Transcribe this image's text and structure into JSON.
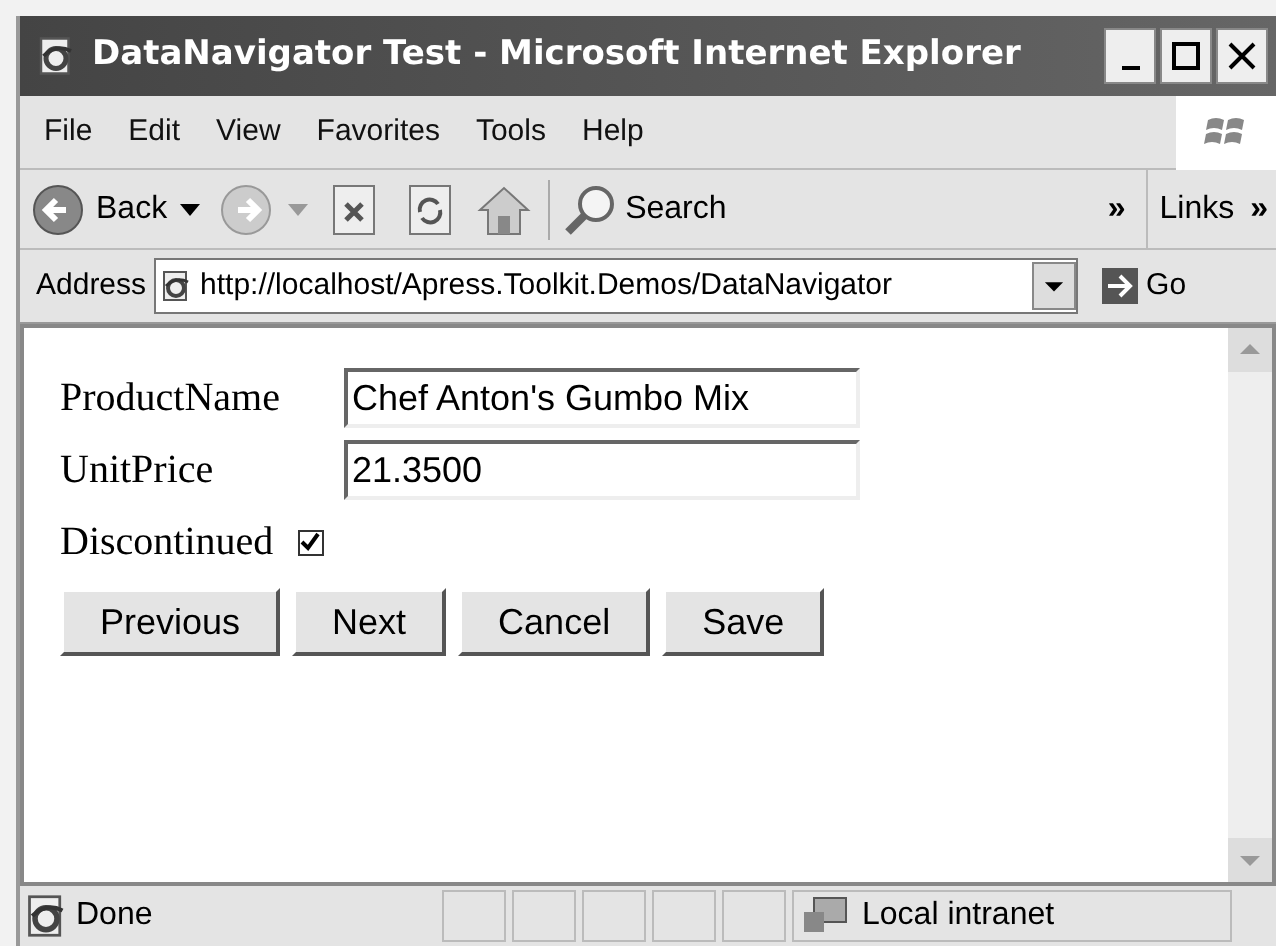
{
  "window": {
    "title": "DataNavigator Test - Microsoft Internet Explorer"
  },
  "menu": [
    "File",
    "Edit",
    "View",
    "Favorites",
    "Tools",
    "Help"
  ],
  "toolbar": {
    "back": "Back",
    "search": "Search",
    "chevron": "»",
    "links": "Links",
    "links_chevron": "»"
  },
  "address": {
    "label": "Address",
    "value": "http://localhost/Apress.Toolkit.Demos/DataNavigator",
    "go": "Go"
  },
  "form": {
    "fields": [
      {
        "label": "ProductName",
        "kind": "text",
        "value": "Chef Anton's Gumbo Mix"
      },
      {
        "label": "UnitPrice",
        "kind": "text",
        "value": "21.3500"
      },
      {
        "label": "Discontinued",
        "kind": "checkbox",
        "checked": true
      }
    ],
    "buttons": [
      "Previous",
      "Next",
      "Cancel",
      "Save"
    ]
  },
  "status_bar": {
    "text": "Done",
    "zone": "Local intranet"
  }
}
